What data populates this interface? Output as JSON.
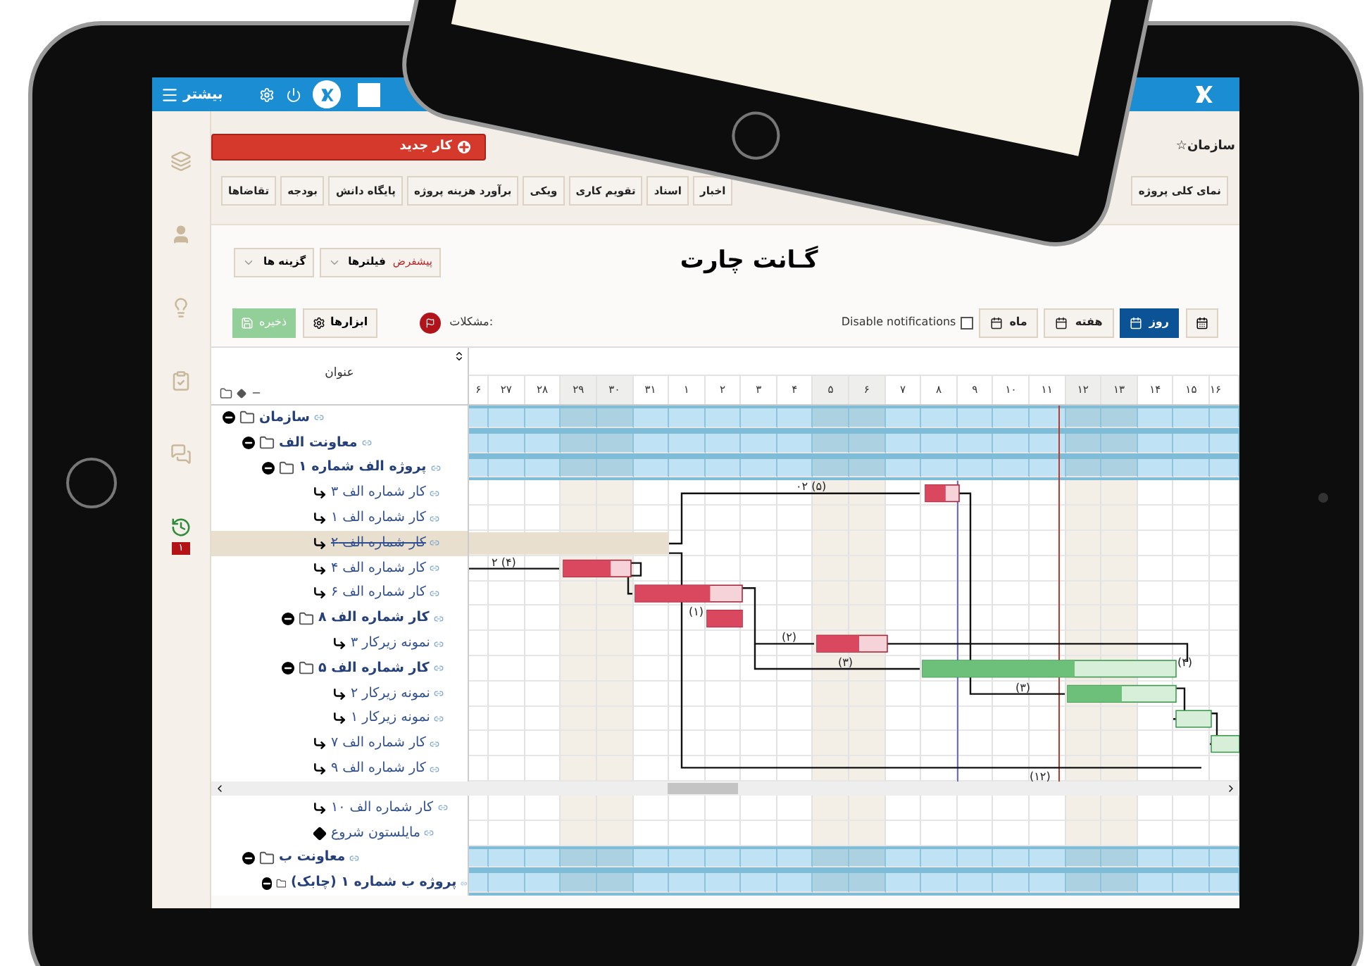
{
  "top_bar": {
    "menu_label": "بیشتر"
  },
  "sidebar": {
    "badge": "۱"
  },
  "new_task_button": "کار جدید",
  "breadcrumb": "سازمان☆",
  "tabs": [
    {
      "label": "نمای کلی پروژه"
    },
    {
      "label": "اخبار"
    },
    {
      "label": "اسناد"
    },
    {
      "label": "تقویم کاری"
    },
    {
      "label": "ویکی"
    },
    {
      "label": "برآورد هزینه پروژه"
    },
    {
      "label": "پایگاه دانش"
    },
    {
      "label": "بودجه"
    },
    {
      "label": "تقاضاها"
    }
  ],
  "title": "گـانت چارت",
  "filters": {
    "label": "فیلترها",
    "value": "پیشفرض"
  },
  "options_label": "گزینه ها",
  "toolbar": {
    "save": "ذخیره",
    "tools": "ابزارها",
    "problems": "مشکلات:",
    "notifications": {
      "label": "Disable notifications",
      "checked": false
    },
    "views": [
      {
        "label": "روز",
        "selected": true
      },
      {
        "label": "هفته",
        "selected": false
      },
      {
        "label": "ماه",
        "selected": false
      }
    ]
  },
  "gantt": {
    "column_title": "عنوان",
    "days": [
      {
        "label": "۱۶",
        "weekend": false
      },
      {
        "label": "۱۵",
        "weekend": false
      },
      {
        "label": "۱۴",
        "weekend": false
      },
      {
        "label": "۱۳",
        "weekend": true
      },
      {
        "label": "۱۲",
        "weekend": true
      },
      {
        "label": "۱۱",
        "weekend": false
      },
      {
        "label": "۱۰",
        "weekend": false
      },
      {
        "label": "۹",
        "weekend": false
      },
      {
        "label": "۸",
        "weekend": false
      },
      {
        "label": "۷",
        "weekend": false
      },
      {
        "label": "۶",
        "weekend": true
      },
      {
        "label": "۵",
        "weekend": true
      },
      {
        "label": "۴",
        "weekend": false
      },
      {
        "label": "۳",
        "weekend": false
      },
      {
        "label": "۲",
        "weekend": false
      },
      {
        "label": "۱",
        "weekend": false
      },
      {
        "label": "۳۱",
        "weekend": false
      },
      {
        "label": "۳۰",
        "weekend": true
      },
      {
        "label": "۲۹",
        "weekend": true
      },
      {
        "label": "۲۸",
        "weekend": false
      },
      {
        "label": "۲۷",
        "weekend": false
      },
      {
        "label": "۶",
        "weekend": false
      }
    ],
    "tree": [
      {
        "label": "سازمان",
        "kind": "org",
        "expanded": true,
        "selected": false,
        "completed": false,
        "children": [
          {
            "label": "معاونت الف",
            "kind": "unit",
            "expanded": true,
            "selected": false,
            "completed": false,
            "children": [
              {
                "label": "پروژه الف شماره ۱",
                "kind": "project",
                "expanded": true,
                "selected": false,
                "completed": false,
                "children": [
                  {
                    "label": "کار شماره الف ۳",
                    "kind": "task",
                    "selected": false,
                    "completed": false
                  },
                  {
                    "label": "کار شماره الف ۱",
                    "kind": "task",
                    "selected": false,
                    "completed": false
                  },
                  {
                    "label": "کار شماره الف ۲",
                    "kind": "task",
                    "selected": true,
                    "completed": true
                  },
                  {
                    "label": "کار شماره الف ۴",
                    "kind": "task",
                    "selected": false,
                    "completed": false
                  },
                  {
                    "label": "کار شماره الف ۶",
                    "kind": "task",
                    "selected": false,
                    "completed": false
                  },
                  {
                    "label": "کار شماره الف ۸",
                    "kind": "group",
                    "expanded": true,
                    "selected": false,
                    "completed": false,
                    "children": [
                      {
                        "label": "نمونه زیرکار ۳",
                        "kind": "task",
                        "selected": false,
                        "completed": false
                      }
                    ]
                  },
                  {
                    "label": "کار شماره الف ۵",
                    "kind": "group",
                    "expanded": true,
                    "selected": false,
                    "completed": false,
                    "children": [
                      {
                        "label": "نمونه زیرکار ۲",
                        "kind": "task",
                        "selected": false,
                        "completed": false
                      },
                      {
                        "label": "نمونه زیرکار ۱",
                        "kind": "task",
                        "selected": false,
                        "completed": false
                      }
                    ]
                  },
                  {
                    "label": "کار شماره الف ۷",
                    "kind": "task",
                    "selected": false,
                    "completed": false
                  },
                  {
                    "label": "کار شماره الف ۹",
                    "kind": "task",
                    "selected": false,
                    "completed": false
                  },
                  {
                    "label": "کار شماره الف ۱۰",
                    "kind": "task",
                    "selected": false,
                    "completed": false
                  },
                  {
                    "label": "مایلستون شروع",
                    "kind": "milestone",
                    "selected": false,
                    "completed": false
                  }
                ]
              }
            ]
          },
          {
            "label": "معاونت ب",
            "kind": "unit",
            "expanded": true,
            "selected": false,
            "completed": false,
            "children": [
              {
                "label": "پروژه ب شماره ۱ (چابک)",
                "kind": "project",
                "expanded": true,
                "selected": false,
                "completed": false
              }
            ]
          }
        ]
      }
    ],
    "link_labels": [
      "۰۲ (۵)",
      "۲ (۴)",
      "(۱)",
      "(۲)",
      "(۳)",
      "(۴)",
      "(۳)",
      "(۱۲)"
    ]
  }
}
